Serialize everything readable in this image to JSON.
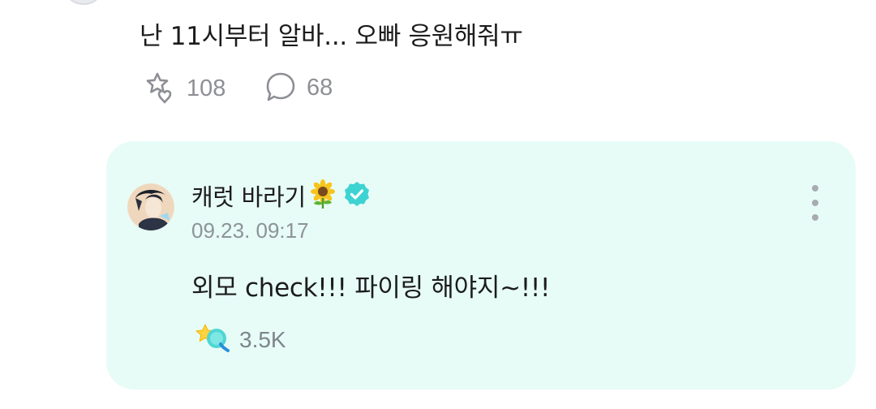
{
  "comment": {
    "text": "난 11시부터 알바... 오빠 응원해줘ㅠ",
    "like_count": "108",
    "reply_count": "68",
    "like_icon": "star-heart-outline-icon",
    "reply_icon": "speech-bubble-outline-icon"
  },
  "reply": {
    "author_name": "캐럿 바라기",
    "author_emoji": "sunflower-icon",
    "verified_icon": "verified-badge-icon",
    "timestamp": "09.23. 09:17",
    "text": "외모 check!!! 파이링 해야지~!!!",
    "like_count": "3.5K",
    "like_icon": "star-heart-filled-icon",
    "more_icon": "more-vertical-icon"
  },
  "colors": {
    "reply_background": "#e7fcf7",
    "verified": "#3ed3d3",
    "muted_text": "#8d8f95",
    "primary_text": "#1c1c1c"
  }
}
